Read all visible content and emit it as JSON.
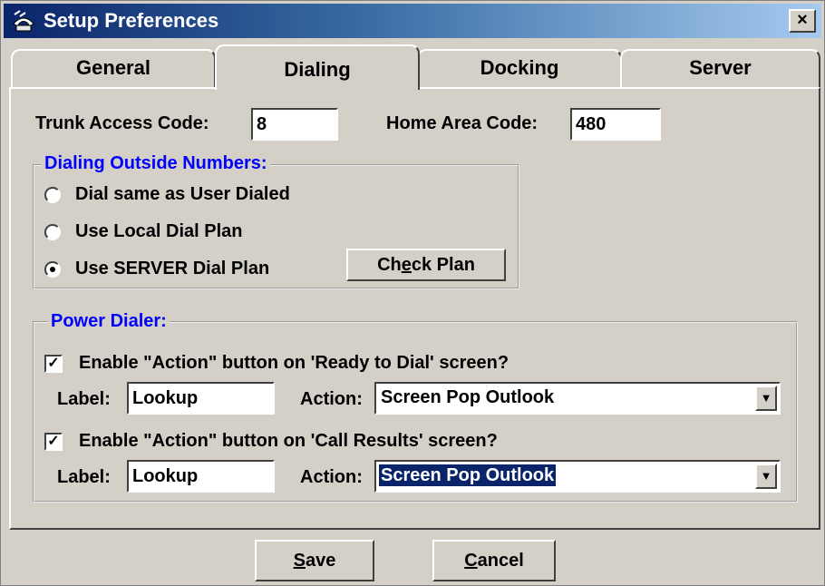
{
  "window": {
    "title": "Setup Preferences",
    "close_glyph": "×",
    "app_icon": "phone-icon"
  },
  "tabs": [
    {
      "label": "General",
      "active": false
    },
    {
      "label": "Dialing",
      "active": true
    },
    {
      "label": "Docking",
      "active": false
    },
    {
      "label": "Server",
      "active": false
    }
  ],
  "trunk": {
    "label": "Trunk Access Code:",
    "value": "8"
  },
  "area": {
    "label": "Home Area Code:",
    "value": "480"
  },
  "outside": {
    "legend": "Dialing Outside Numbers:",
    "options": [
      {
        "label": "Dial same as User Dialed",
        "selected": false
      },
      {
        "label": "Use Local Dial Plan",
        "selected": false
      },
      {
        "label": "Use SERVER Dial Plan",
        "selected": true
      }
    ],
    "check_plan": {
      "pre": "Ch",
      "accel": "e",
      "post": "ck Plan"
    }
  },
  "power": {
    "legend": "Power Dialer:",
    "rows": [
      {
        "enable_label": "Enable \"Action\" button on 'Ready to Dial' screen?",
        "checked": true,
        "label_caption": "Label:",
        "label_value": "Lookup",
        "action_caption": "Action:",
        "action_value": "Screen Pop Outlook"
      },
      {
        "enable_label": "Enable \"Action\" button on 'Call Results' screen?",
        "checked": true,
        "label_caption": "Label:",
        "label_value": "Lookup",
        "action_caption": "Action:",
        "action_value": "Screen Pop Outlook"
      }
    ]
  },
  "footer": {
    "save": {
      "accel": "S",
      "rest": "ave"
    },
    "cancel": {
      "accel": "C",
      "rest": "ancel"
    }
  },
  "check_glyph": "✓",
  "arrow_glyph": "▼"
}
